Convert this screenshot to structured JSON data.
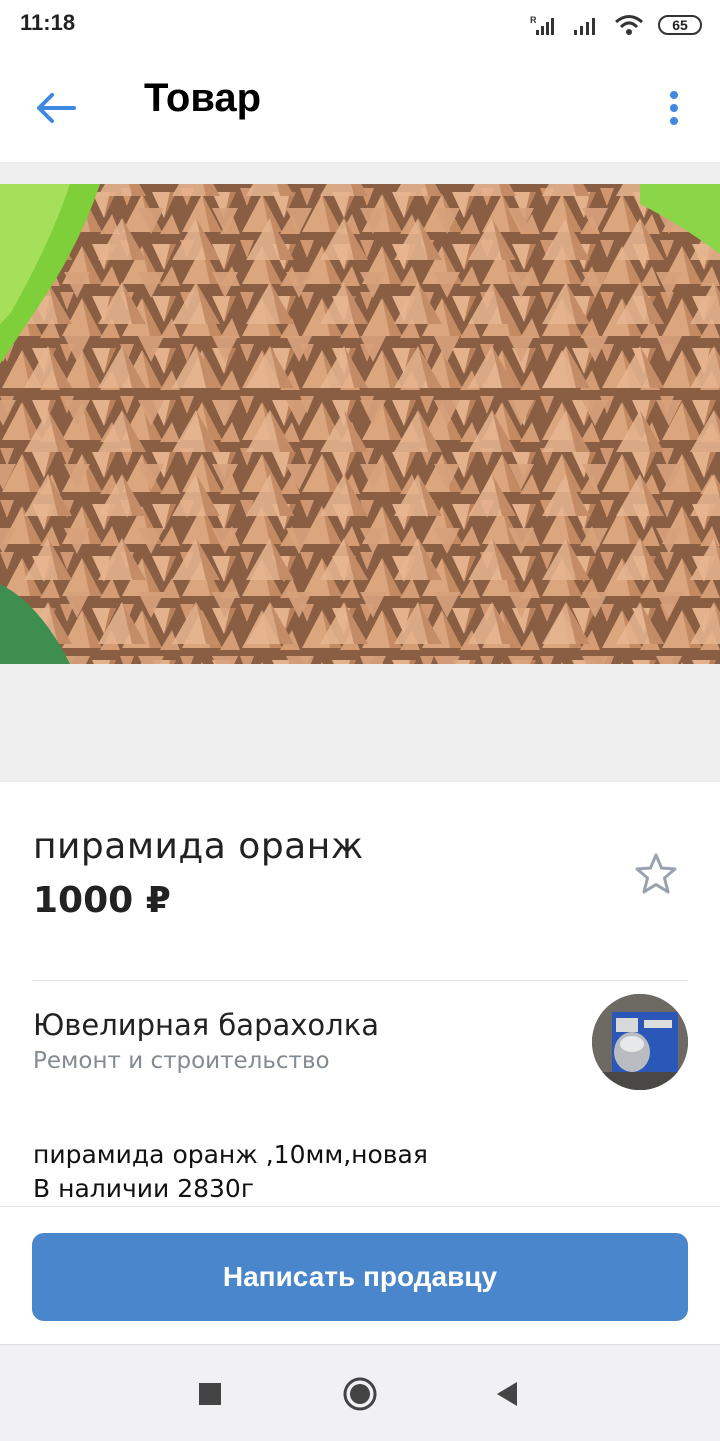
{
  "status_bar": {
    "time": "11:18",
    "battery": "65",
    "icons": [
      "signal-roaming-icon",
      "signal-icon",
      "wifi-icon",
      "battery-icon"
    ]
  },
  "header": {
    "title": "Товар",
    "back_icon": "arrow-left-icon",
    "menu_icon": "more-vertical-icon"
  },
  "product": {
    "title": "пирамида оранж",
    "price": "1000 ₽",
    "favorite_icon": "star-outline-icon",
    "photo_icon": "product-photo"
  },
  "seller": {
    "name": "Ювелирная барахолка",
    "category": "Ремонт и строительство"
  },
  "description": {
    "lines": [
      "пирамида оранж ,10мм,новая",
      "В наличии 2830г"
    ]
  },
  "actions": {
    "write_seller": "Написать продавцу"
  },
  "nav": {
    "recents_icon": "square-icon",
    "home_icon": "circle-icon",
    "back_icon": "triangle-back-icon"
  },
  "colors": {
    "accent": "#4a86cb",
    "icon_blue": "#3f8ae0",
    "secondary_text": "#828a92",
    "pyramid": "#d9a27a"
  }
}
